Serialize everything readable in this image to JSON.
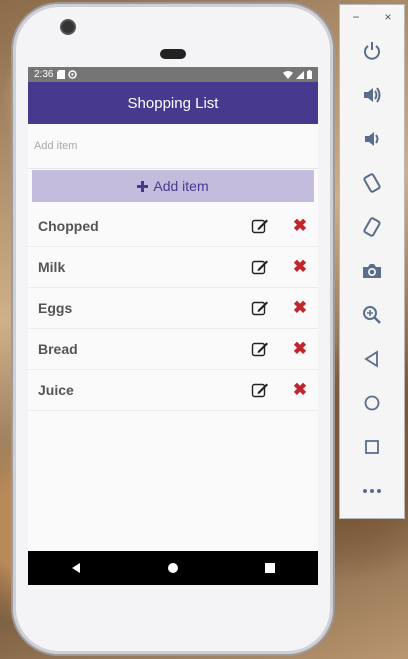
{
  "status": {
    "time": "2:36"
  },
  "app": {
    "title": "Shopping List"
  },
  "input": {
    "placeholder": "Add item",
    "value": ""
  },
  "add_button": {
    "icon": "plus-icon",
    "label": "Add item"
  },
  "items": [
    {
      "label": "Chopped"
    },
    {
      "label": "Milk"
    },
    {
      "label": "Eggs"
    },
    {
      "label": "Bread"
    },
    {
      "label": "Juice"
    }
  ],
  "emulator": {
    "minimize": "−",
    "close": "×"
  },
  "colors": {
    "primary": "#473a8e",
    "button_bg": "#c4bcdc",
    "delete": "#c0262d"
  }
}
